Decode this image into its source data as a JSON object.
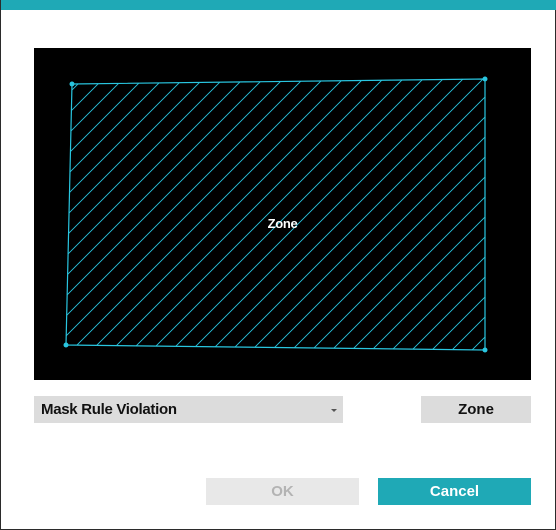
{
  "dialog": {
    "accent_color": "#1fa9b6"
  },
  "preview": {
    "zone_label": "Zone",
    "zone_line_color": "#29c6e0"
  },
  "mask_select": {
    "value": "Mask Rule Violation",
    "icon": "chevron-down-icon"
  },
  "buttons": {
    "zone_label": "Zone",
    "ok_label": "OK",
    "ok_enabled": false,
    "cancel_label": "Cancel"
  }
}
